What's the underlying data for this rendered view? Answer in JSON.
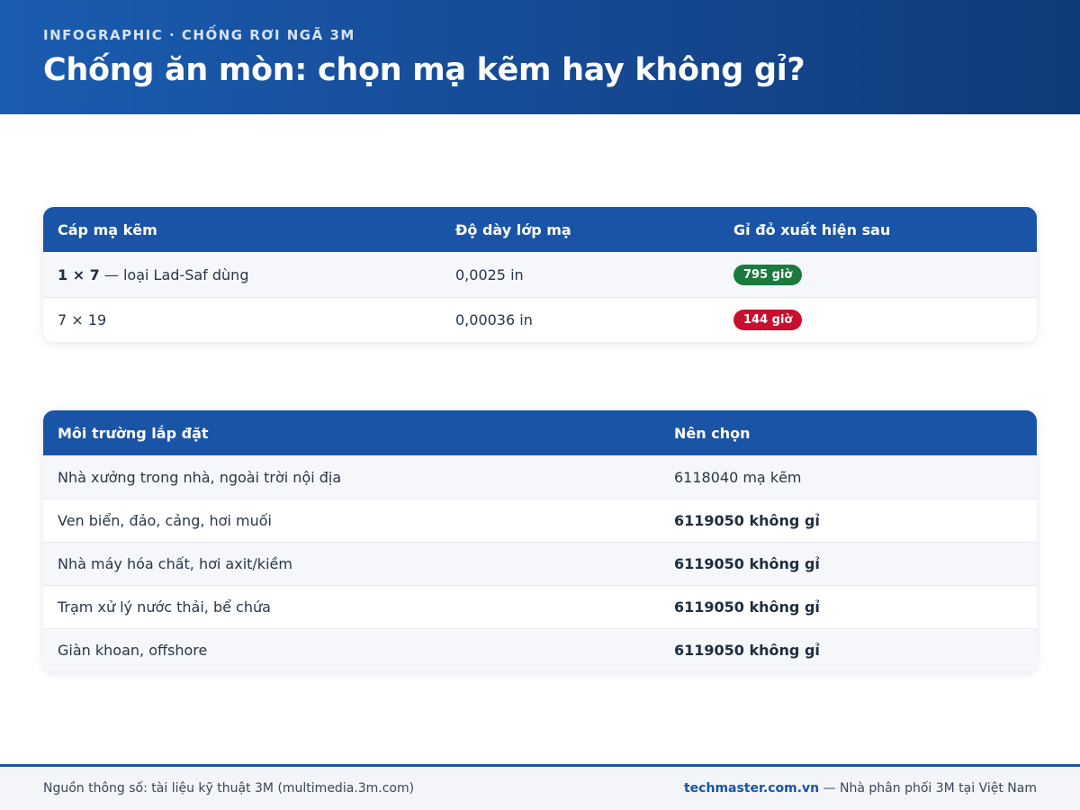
{
  "header": {
    "kicker": "INFOGRAPHIC · CHỐNG RƠI NGÃ 3M",
    "title": "Chống ăn mòn: chọn mạ kẽm hay không gỉ?"
  },
  "cable_table": {
    "columns": [
      "Cáp mạ kẽm",
      "Độ dày lớp mạ",
      "Gỉ đỏ xuất hiện sau"
    ],
    "rows": [
      {
        "name_bold": "1 × 7",
        "name_rest": " — loại Lad-Saf dùng",
        "thickness": "0,0025 in",
        "rust": "795 giờ",
        "rust_color": "#1b7a3e"
      },
      {
        "name_bold": "",
        "name_rest": "7 × 19",
        "thickness": "0,00036 in",
        "rust": "144 giờ",
        "rust_color": "#c8102e"
      }
    ]
  },
  "env_table": {
    "columns": [
      "Môi trường lắp đặt",
      "Nên chọn"
    ],
    "rows": [
      {
        "env": "Nhà xưởng trong nhà, ngoài trời nội địa",
        "choice": "6118040 mạ kẽm"
      },
      {
        "env": "Ven biển, đảo, cảng, hơi muối",
        "choice": "6119050 không gỉ"
      },
      {
        "env": "Nhà máy hóa chất, hơi axit/kiềm",
        "choice": "6119050 không gỉ"
      },
      {
        "env": "Trạm xử lý nước thải, bể chứa",
        "choice": "6119050 không gỉ"
      },
      {
        "env": "Giàn khoan, offshore",
        "choice": "6119050 không gỉ"
      }
    ]
  },
  "footer": {
    "source": "Nguồn thông số: tài liệu kỹ thuật 3M (multimedia.3m.com)",
    "brand": "techmaster.com.vn",
    "tagline": " — Nhà phân phối 3M tại Việt Nam"
  },
  "colors": {
    "primary": "#1a54a6",
    "good": "#1b7a3e",
    "bad": "#c8102e"
  }
}
